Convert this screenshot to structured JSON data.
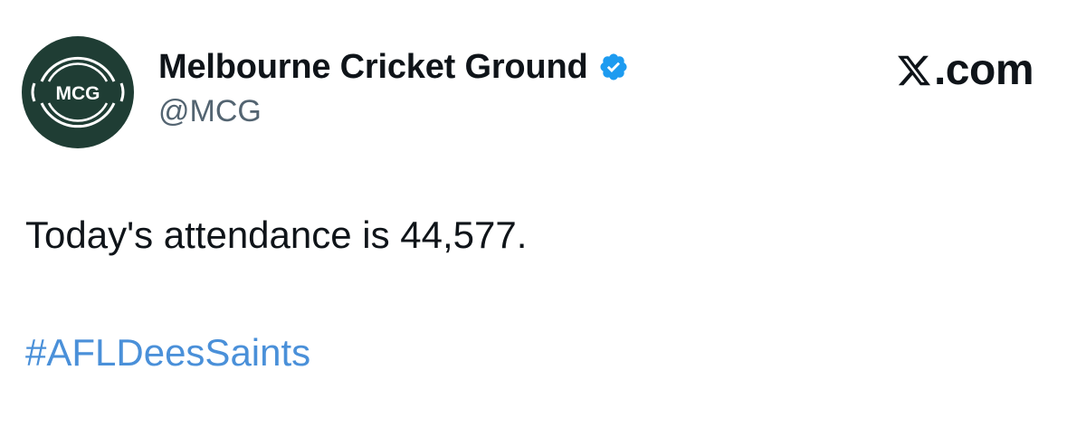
{
  "account": {
    "display_name": "Melbourne Cricket Ground",
    "handle": "@MCG",
    "avatar_text": "MCG",
    "verified": true
  },
  "brand": {
    "name": ".com",
    "logo_icon": "x-logo-icon"
  },
  "tweet": {
    "text": "Today's attendance is 44,577.",
    "hashtag": "#AFLDeesSaints"
  },
  "colors": {
    "avatar_bg": "#1f3d34",
    "verified_badge": "#1d9bf0",
    "hashtag": "#4a90d9",
    "handle": "#536471",
    "text": "#0f1419"
  }
}
